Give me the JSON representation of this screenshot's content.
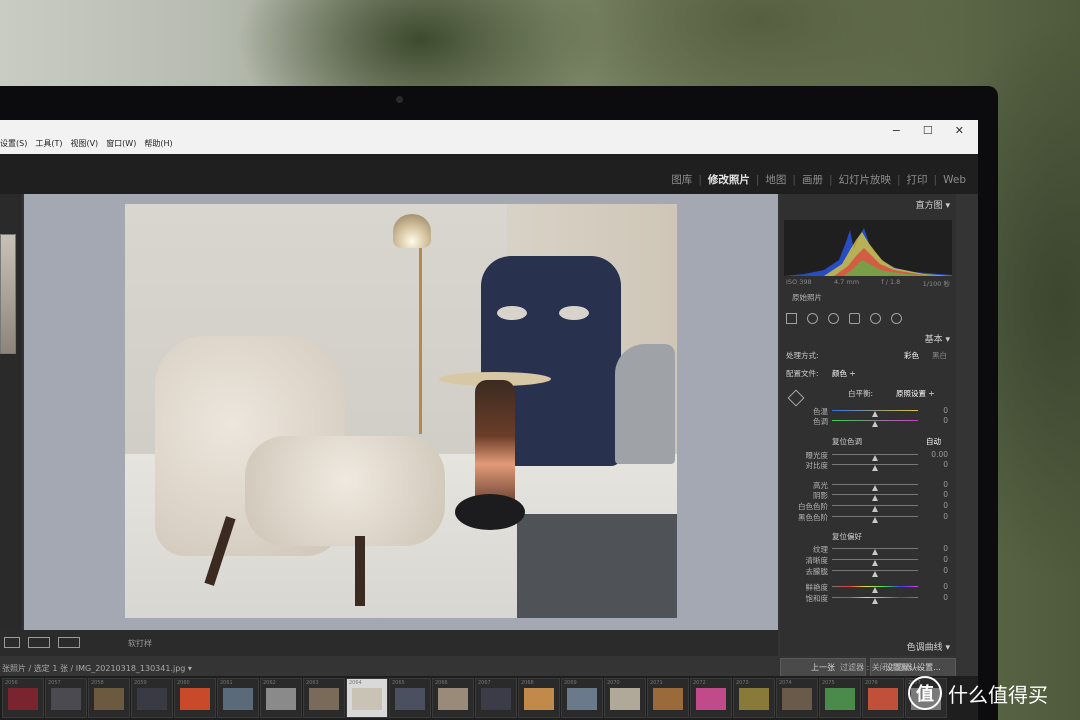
{
  "menu": [
    "设置(S)",
    "工具(T)",
    "视图(V)",
    "窗口(W)",
    "帮助(H)"
  ],
  "window_controls": [
    "−",
    "☐",
    "✕"
  ],
  "modules": [
    {
      "label": "图库",
      "active": false
    },
    {
      "label": "修改照片",
      "active": true
    },
    {
      "label": "地图",
      "active": false
    },
    {
      "label": "画册",
      "active": false
    },
    {
      "label": "幻灯片放映",
      "active": false
    },
    {
      "label": "打印",
      "active": false
    },
    {
      "label": "Web",
      "active": false
    }
  ],
  "histogram": {
    "title": "直方图 ▾",
    "exif": [
      "ISO 398",
      "4.7 mm",
      "f / 1.8",
      "1/100 秒"
    ],
    "original_photo": "原始照片"
  },
  "basic": {
    "title": "基本 ▾",
    "treatment_label": "处理方式:",
    "treatment_color": "彩色",
    "treatment_bw": "黑白",
    "profile_label": "配置文件:",
    "profile_value": "颜色 ÷",
    "wb_label": "白平衡:",
    "wb_value": "原照设置 ÷",
    "temp_label": "色温",
    "temp_value": "0",
    "tint_label": "色调",
    "tint_value": "0",
    "tone_label": "复位色调",
    "tone_auto": "自动",
    "exposure_label": "曝光度",
    "exposure_value": "0.00",
    "contrast_label": "对比度",
    "contrast_value": "0",
    "highlights_label": "高光",
    "highlights_value": "0",
    "shadows_label": "阴影",
    "shadows_value": "0",
    "whites_label": "白色色阶",
    "whites_value": "0",
    "blacks_label": "黑色色阶",
    "blacks_value": "0",
    "presence_label": "复位偏好",
    "texture_label": "纹理",
    "texture_value": "0",
    "clarity_label": "清晰度",
    "clarity_value": "0",
    "dehaze_label": "去朦胧",
    "dehaze_value": "0",
    "vibrance_label": "鲜艳度",
    "vibrance_value": "0",
    "saturation_label": "饱和度",
    "saturation_value": "0"
  },
  "tone_curve_title": "色调曲线 ▾",
  "buttons": {
    "previous": "上一张",
    "reset": "设置默认设置..."
  },
  "toolbar": {
    "softproof": "软打样"
  },
  "filmstrip": {
    "info": "张照片 / 选定 1 张 / IMG_20210318_130341.jpg ▾",
    "filter_label": "过滤器 :",
    "filter_value": "关闭过滤器 ÷",
    "numbers": [
      "2056",
      "2057",
      "2058",
      "2059",
      "2060",
      "2061",
      "2062",
      "2063",
      "2064",
      "2065",
      "2066",
      "2067",
      "2068",
      "2069",
      "2070",
      "2071",
      "2072",
      "2073",
      "2074",
      "2075",
      "2076",
      "2077"
    ],
    "selected_index": 8
  },
  "watermark": {
    "icon": "值",
    "text": "什么值得买"
  }
}
